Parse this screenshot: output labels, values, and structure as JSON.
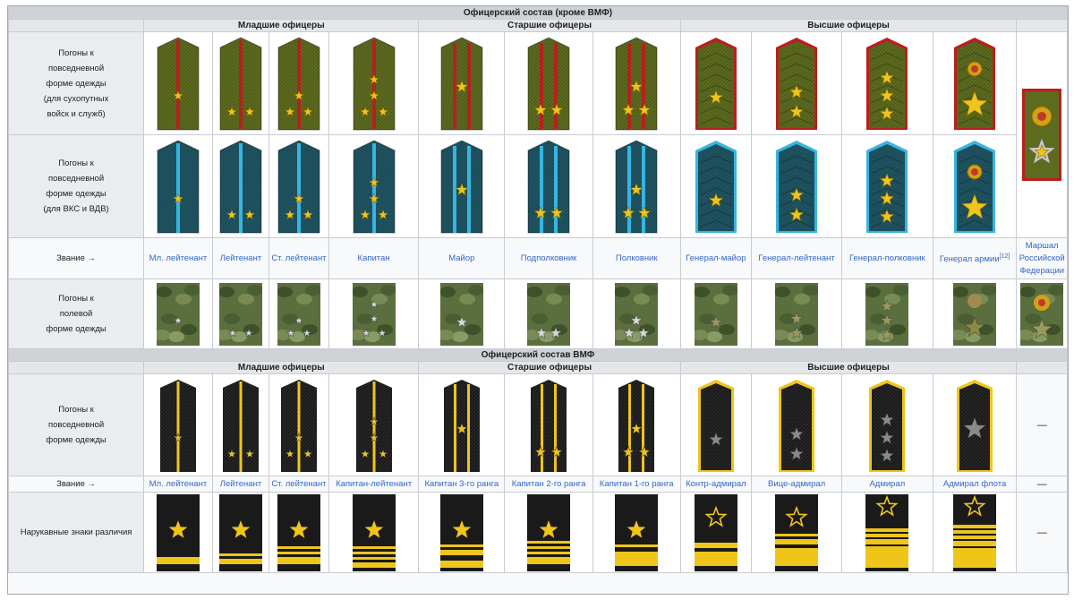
{
  "army": {
    "title": "Офицерский состав (кроме ВМФ)",
    "groups": [
      "Младшие офицеры",
      "Старшие офицеры",
      "Высшие офицеры"
    ],
    "row_daily_ground_label": [
      "Погоны к",
      "повседневной",
      "форме одежды",
      "(для сухопутных",
      "войск и служб)"
    ],
    "row_daily_vks_label": [
      "Погоны к",
      "повседневной",
      "форме одежды",
      "(для ВКС и ВДВ)"
    ],
    "rank_label": "Звание →",
    "ranks": [
      "Мл. лейтенант",
      "Лейтенант",
      "Ст. лейтенант",
      "Капитан",
      "Майор",
      "Подполковник",
      "Полковник",
      "Генерал-майор",
      "Генерал-лейтенант",
      "Генерал-полковник",
      "Генерал армии",
      "Маршал Российской Федерации"
    ],
    "general_army_ref": "[12]",
    "marshal_lines": [
      "Маршал",
      "Российской",
      "Федерации"
    ],
    "row_field_label": [
      "Погоны к",
      "полевой",
      "форме одежды"
    ]
  },
  "navy": {
    "title": "Офицерский состав ВМФ",
    "groups": [
      "Младшие офицеры",
      "Старшие офицеры",
      "Высшие офицеры"
    ],
    "row_daily_label": [
      "Погоны к",
      "повседневной",
      "форме одежды"
    ],
    "rank_label": "Звание →",
    "ranks": [
      "Мл. лейтенант",
      "Лейтенант",
      "Ст. лейтенант",
      "Капитан-лейтенант",
      "Капитан 3-го ранга",
      "Капитан 2-го ранга",
      "Капитан 1-го ранга",
      "Контр-адмирал",
      "Вице-адмирал",
      "Адмирал",
      "Адмирал флота"
    ],
    "sleeve_label": "Нарукавные знаки различия",
    "dash": "—"
  },
  "colors": {
    "olive": "#5d6b1f",
    "red_stripe": "#b8201e",
    "teal": "#1f5563",
    "blue_stripe": "#38b4e0",
    "black": "#1a1a1a",
    "gold": "#f0c51a",
    "link": "#3366cc"
  },
  "insignia": {
    "stars_per_rank": [
      1,
      2,
      3,
      4,
      1,
      2,
      3,
      1,
      2,
      3,
      1
    ],
    "stripes_per_rank": [
      1,
      1,
      1,
      1,
      2,
      2,
      2,
      0,
      0,
      0,
      0
    ]
  }
}
